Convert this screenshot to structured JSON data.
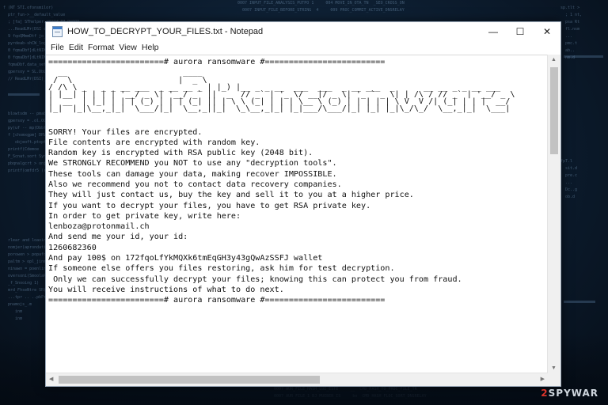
{
  "window": {
    "title": "HOW_TO_DECRYPT_YOUR_FILES.txt - Notepad",
    "controls": {
      "minimize": "—",
      "maximize": "☐",
      "close": "✕"
    }
  },
  "menu": [
    "File",
    "Edit",
    "Format",
    "View",
    "Help"
  ],
  "note": {
    "header": "========================# aurora ransomware #=========================",
    "ascii_art": "  __                        ____                                             \n /  \\                      |  _ \\                                            \n/ /\\ \\ _   _ _ __ ___  _ __ __ _ | |_) |__ _ _ __  ___  ___  _ __ ___  _      __ __ _ _ __ ___ \n| |__| | | | | '__/ _ \\| '__/ _` ||  _  // _` | '_ \\/ __|/ _ \\| '_ ` _ \\| | /\\ / // _` | '__/ _ \\\n|  __  | |_| | | | (_) | | | (_| || | \\ \\ (_| | | | \\__ \\ (_) | | | | | \\ V  V /| (_| | | |  __/\n|_|  |_|\\__,_|_|  \\___/|_|  \\__,_||_|  \\_\\__,_|_| |_|___/\\___/|_| |_| |_|\\_/\\_/  \\__,_|_|  \\___|",
    "body": [
      "SORRY! Your files are encrypted.",
      "File contents are encrypted with random key.",
      "Random key is encrypted with RSA public key (2048 bit).",
      "We STRONGLY RECOMMEND you NOT to use any \"decryption tools\".",
      "These tools can damage your data, making recover IMPOSSIBLE.",
      "Also we recommend you not to contact data recovery companies.",
      "They will just contact us, buy the key and sell it to you at a higher price.",
      "If you want to decrypt your files, you have to get RSA private key.",
      "In order to get private key, write here:",
      "lenboza@protonmail.ch",
      "And send me your id, your id:",
      "1260682360",
      "And pay 100$ on 172fqoLfYkMQXk6tmEqGH3y43gQwAzSSFJ wallet",
      "If someone else offers you files restoring, ask him for test decryption.",
      " Only we can successfully decrypt your files; knowing this can protect you from fraud.",
      "You will receive instructions of what to do next."
    ],
    "footer": "========================# aurora ransomware #========================="
  },
  "watermark": {
    "prefix": "2",
    "rest": "SPYWAR"
  },
  "colors": {
    "background": "#0b1a2c",
    "accent": "#d9342b"
  }
}
